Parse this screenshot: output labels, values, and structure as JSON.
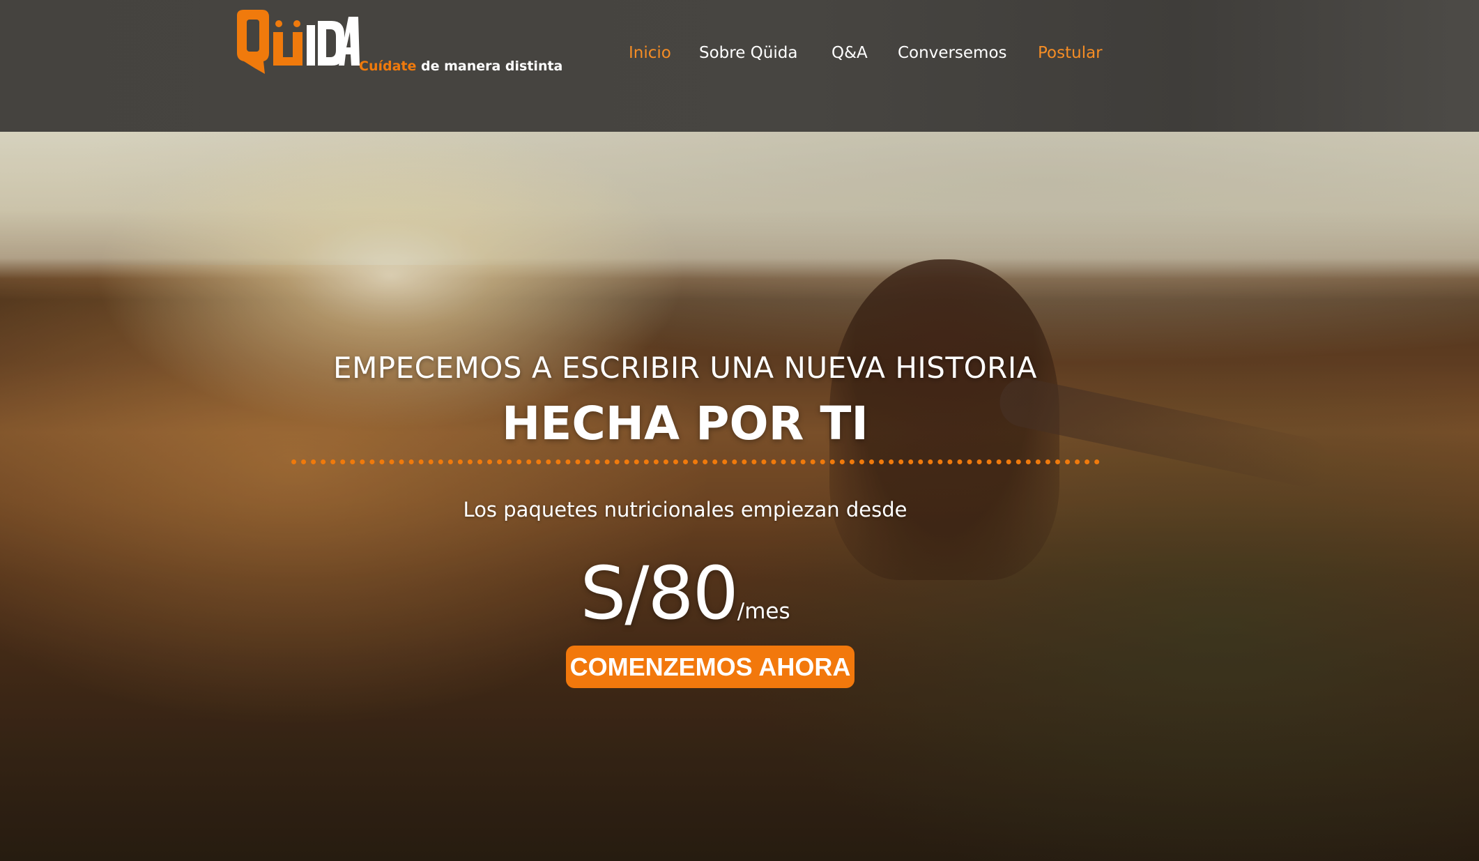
{
  "brand": {
    "logo_text": "QüiDA",
    "tagline_accent": "Cuídate",
    "tagline_rest": " de manera distinta",
    "accent_color": "#f07a0c"
  },
  "nav": {
    "items": [
      {
        "label": "Inicio",
        "state": "active"
      },
      {
        "label": "Sobre Qüida",
        "state": "normal"
      },
      {
        "label": "Q&A",
        "state": "normal"
      },
      {
        "label": "Conversemos",
        "state": "normal"
      },
      {
        "label": "Postular",
        "state": "highlight"
      }
    ],
    "active_color": "#f58d25"
  },
  "hero": {
    "headline": "EMPECEMOS A ESCRIBIR UNA NUEVA HISTORIA",
    "subheadline": "HECHA POR TI",
    "packages_text": "Los paquetes nutricionales empiezan desde",
    "price": "S/80",
    "price_period": "/mes",
    "cta_label": "COMENZEMOS AHORA",
    "cta_color": "#f2780c"
  }
}
